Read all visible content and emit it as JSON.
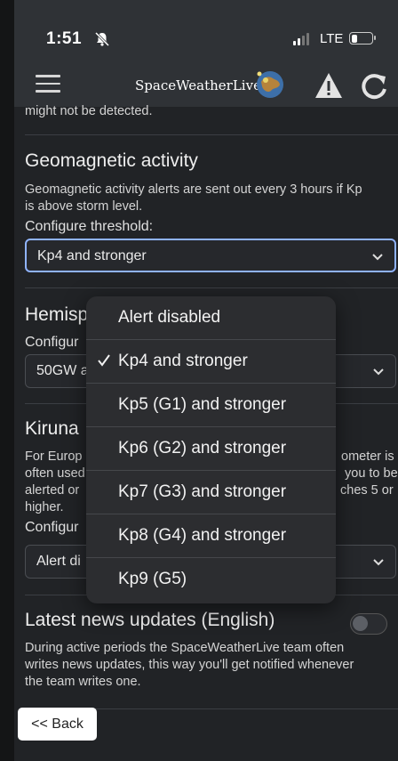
{
  "status_bar": {
    "time": "1:51",
    "network": "LTE"
  },
  "header": {
    "brand": "SpaceWeatherLive"
  },
  "content": {
    "cut_text": "might not be detected.",
    "geomagnetic": {
      "title": "Geomagnetic activity",
      "desc_line1": "Geomagnetic activity alerts are sent out every 3 hours if Kp",
      "desc_line2": "is above storm level.",
      "config_label": "Configure threshold:",
      "selected": "Kp4 and stronger"
    },
    "hemisphere": {
      "title_partial": "Hemisp",
      "config_partial": "Configur",
      "selected_partial": "50GW a"
    },
    "kiruna": {
      "title_partial": "Kiruna",
      "left_lines": [
        "For Europ",
        "often used",
        "alerted or",
        "higher."
      ],
      "right_lines": [
        "ometer is",
        "you to be",
        "ches 5 or"
      ],
      "config_partial": "Configur",
      "selected_partial": "Alert di"
    },
    "news": {
      "title": "Latest news updates (English)",
      "desc_line1": "During active periods the SpaceWeatherLive team often",
      "desc_line2": "writes news updates, this way you'll get notified whenever",
      "desc_line3": "the team writes one."
    },
    "back_label": "<< Back"
  },
  "dropdown": {
    "selected_index": 1,
    "options": [
      "Alert disabled",
      "Kp4 and stronger",
      "Kp5 (G1) and stronger",
      "Kp6 (G2) and stronger",
      "Kp7 (G3) and stronger",
      "Kp8 (G4) and stronger",
      "Kp9 (G5)"
    ]
  },
  "icons": [
    "menu-icon",
    "warning-icon",
    "refresh-icon",
    "chevron-down-icon",
    "checkmark-icon",
    "bell-slash-icon"
  ],
  "colors": {
    "focus_border": "#8fb3ff",
    "background": "#212326",
    "header": "#2f3236",
    "dropdown": "#2c2d30"
  }
}
